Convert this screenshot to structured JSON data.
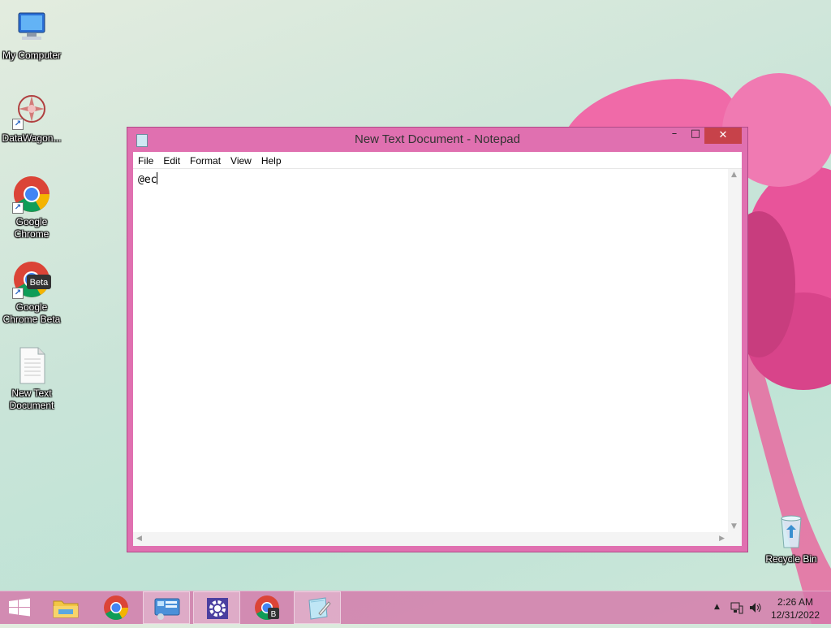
{
  "desktop": {
    "icons": [
      {
        "label": "My Computer",
        "icon": "computer-icon"
      },
      {
        "label": "DataWagon...",
        "icon": "datawagon-icon"
      },
      {
        "label": "Google Chrome",
        "icon": "chrome-icon"
      },
      {
        "label": "Google Chrome Beta",
        "icon": "chrome-beta-icon",
        "badge": "Beta"
      },
      {
        "label": "New Text Document",
        "icon": "text-file-icon"
      },
      {
        "label": "Recycle Bin",
        "icon": "recycle-bin-icon"
      }
    ]
  },
  "window": {
    "title": "New Text Document - Notepad",
    "controls": {
      "minimize": "–",
      "maximize": "□",
      "close": "✕"
    },
    "menu": [
      "File",
      "Edit",
      "Format",
      "View",
      "Help"
    ],
    "content": "@ec"
  },
  "taskbar": {
    "items": [
      "start-button",
      "file-explorer",
      "chrome",
      "control-panel",
      "settings",
      "chrome-beta",
      "notepad"
    ],
    "chrome_beta_badge": "B",
    "time": "2:26 AM",
    "date": "12/31/2022"
  },
  "colors": {
    "accent": "#e070b0",
    "close": "#c7424a",
    "taskbar": "#d678aa"
  }
}
